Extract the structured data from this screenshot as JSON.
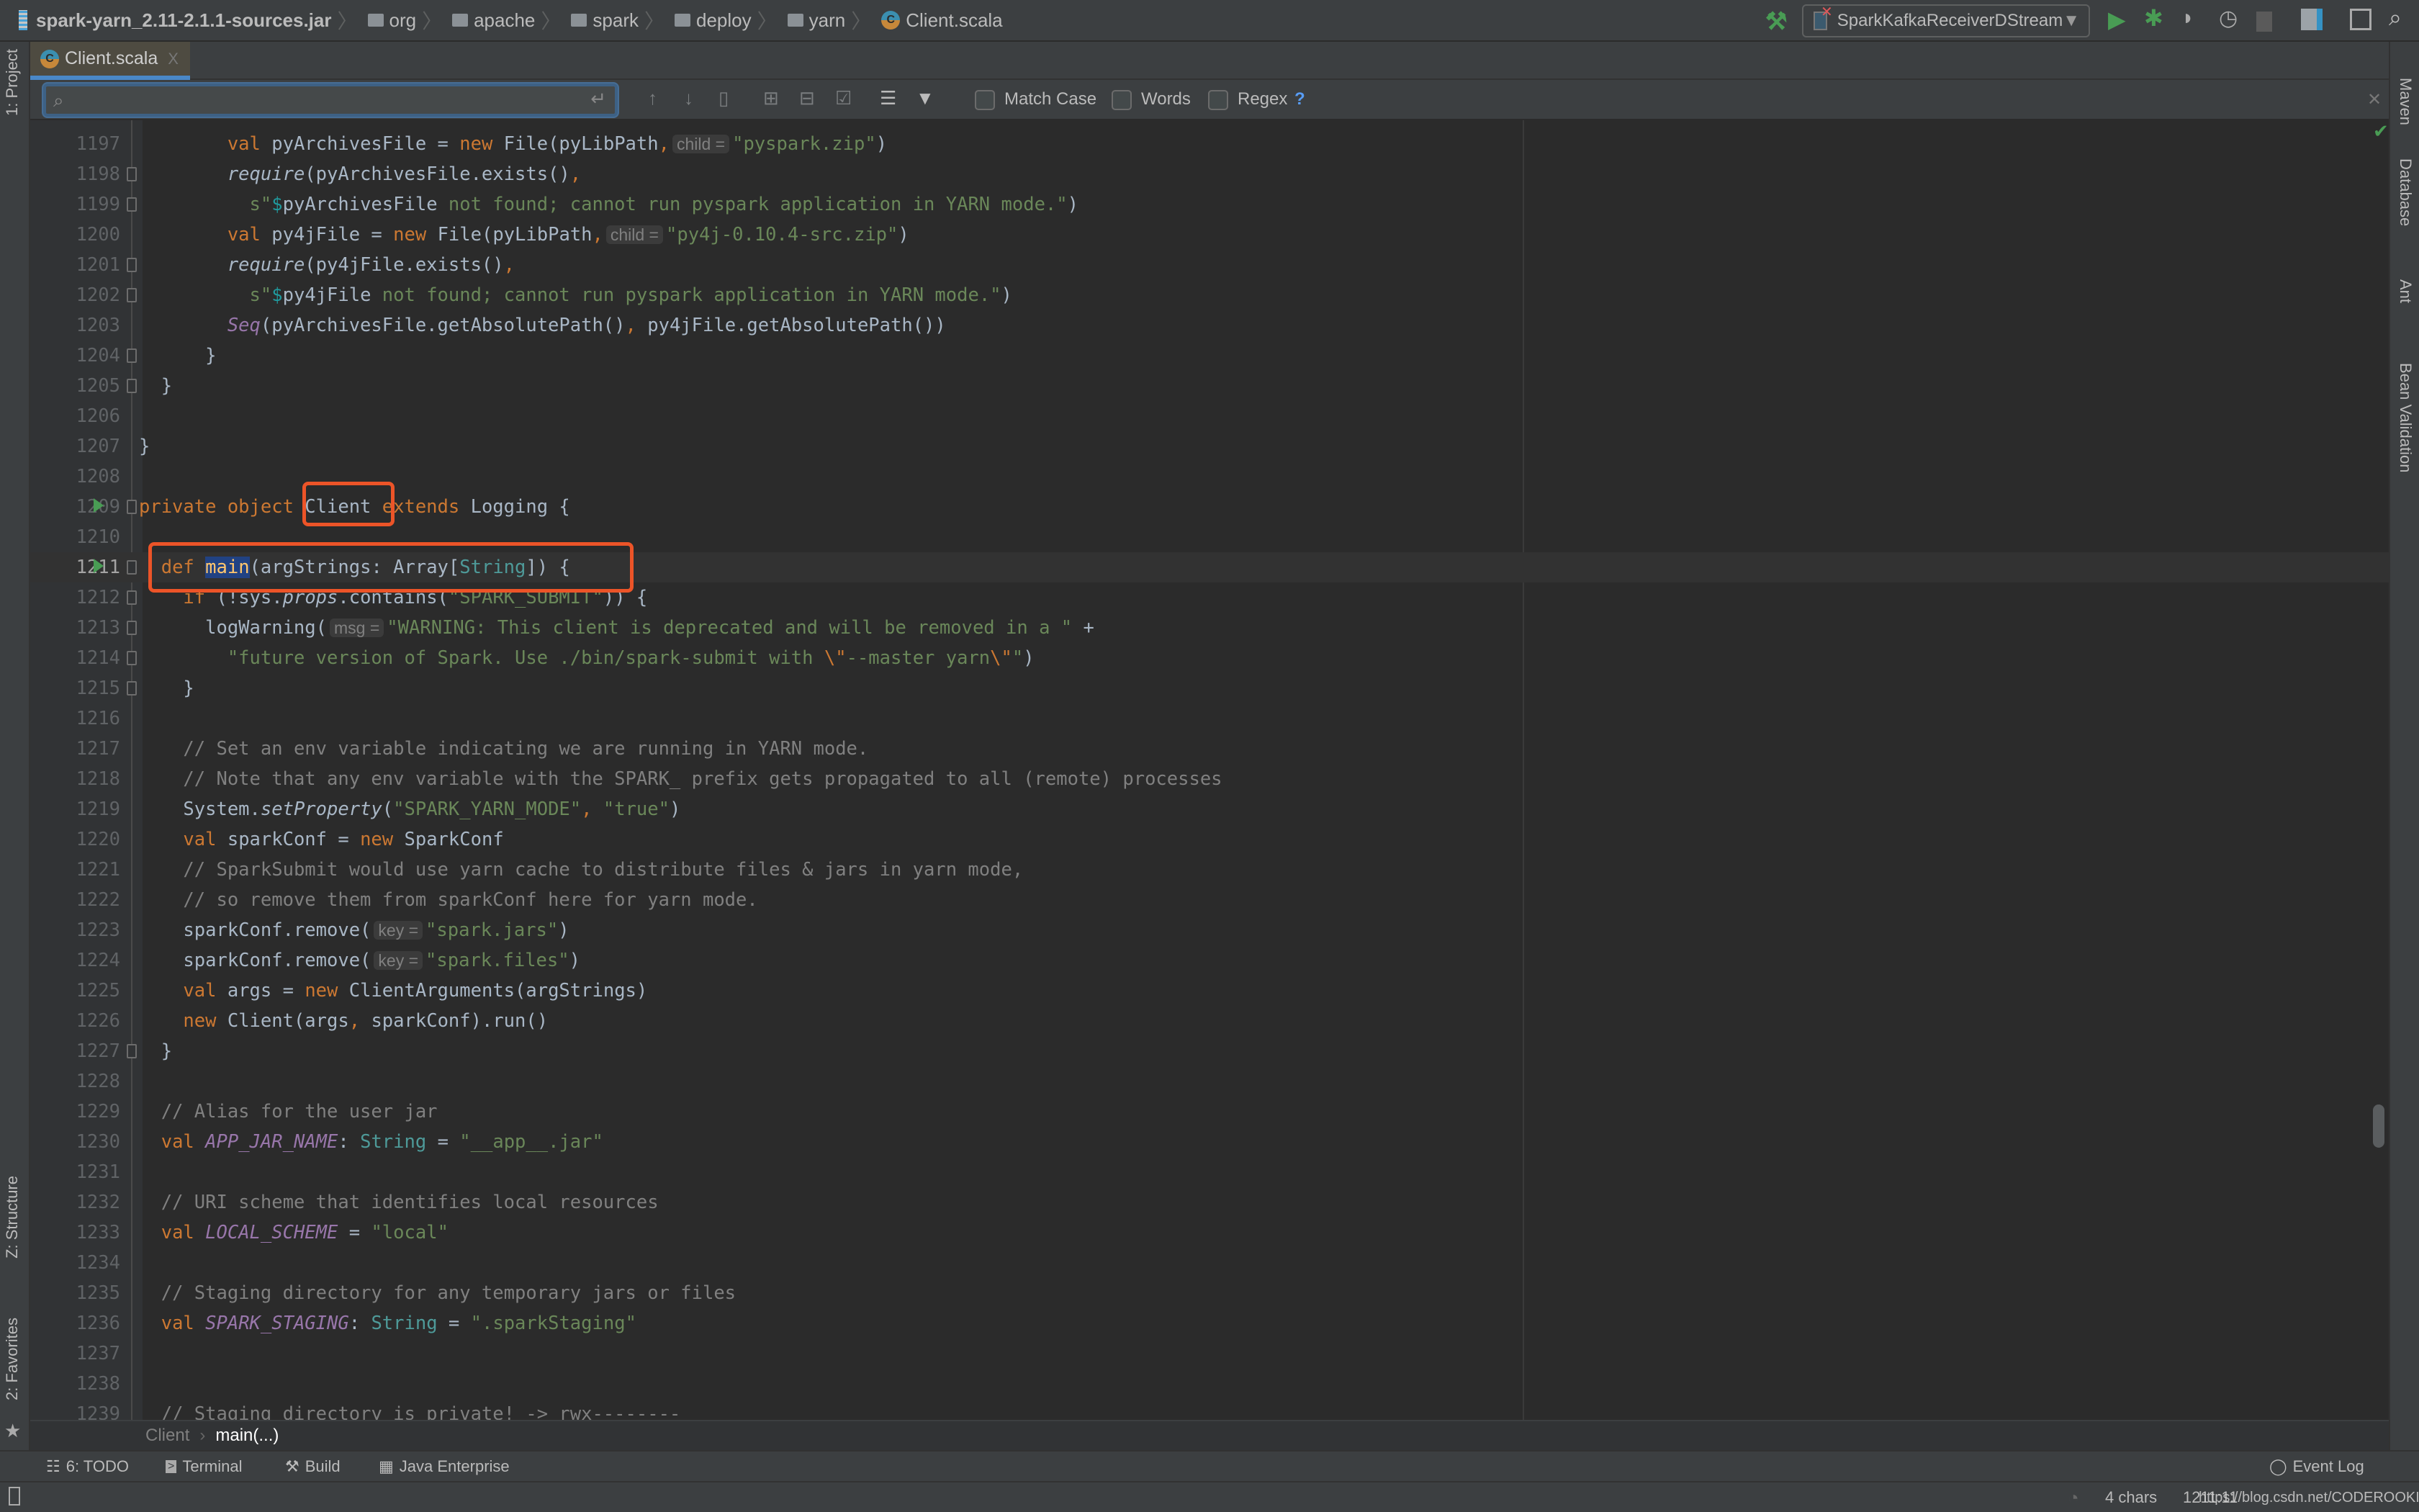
{
  "breadcrumb": {
    "jar": "spark-yarn_2.11-2.1.1-sources.jar",
    "folders": [
      "org",
      "apache",
      "spark",
      "deploy",
      "yarn"
    ],
    "file": "Client.scala"
  },
  "run_config": "SparkKafkaReceiverDStream",
  "toolbar_icons": [
    "build-hammer-icon",
    "run-icon",
    "debug-icon",
    "coverage-icon",
    "profile-icon",
    "stop-icon",
    "project-structure-icon",
    "terminal-window-icon",
    "search-icon"
  ],
  "tab": {
    "label": "Client.scala",
    "close": "X"
  },
  "search": {
    "value": "",
    "match_case": "Match Case",
    "words": "Words",
    "regex": "Regex",
    "help": "?",
    "match_case_checked": false,
    "words_checked": false,
    "regex_checked": false
  },
  "left_tools": [
    "1: Project",
    "Z: Structure",
    "2: Favorites"
  ],
  "right_tools": [
    "Maven",
    "Database",
    "Ant",
    "Bean Validation"
  ],
  "code": {
    "current_line": 1211,
    "lines": [
      {
        "n": "1197",
        "t": [
          [
            "i",
            "        "
          ],
          [
            "k",
            "val "
          ],
          [
            "i",
            "pyArchivesFile = "
          ],
          [
            "k",
            "new "
          ],
          [
            "i",
            "File(pyLibPath"
          ],
          [
            "k",
            ","
          ],
          [
            "h",
            "child ="
          ],
          [
            "s",
            "\"pyspark.zip\""
          ],
          [
            "i",
            ")"
          ]
        ]
      },
      {
        "n": "1198",
        "t": [
          [
            "i",
            "        "
          ],
          [
            "mi",
            "require"
          ],
          [
            "i",
            "(pyArchivesFile.exists()"
          ],
          [
            "k",
            ","
          ]
        ]
      },
      {
        "n": "1199",
        "t": [
          [
            "i",
            "          "
          ],
          [
            "s",
            "s\""
          ],
          [
            "d",
            "$"
          ],
          [
            "i",
            "pyArchivesFile"
          ],
          [
            "s",
            " not found; cannot run pyspark application in YARN mode.\""
          ],
          [
            "i",
            ")"
          ]
        ]
      },
      {
        "n": "1200",
        "t": [
          [
            "i",
            "        "
          ],
          [
            "k",
            "val "
          ],
          [
            "i",
            "py4jFile = "
          ],
          [
            "k",
            "new "
          ],
          [
            "i",
            "File(pyLibPath"
          ],
          [
            "k",
            ","
          ],
          [
            "h",
            "child ="
          ],
          [
            "s",
            "\"py4j-0.10.4-src.zip\""
          ],
          [
            "i",
            ")"
          ]
        ]
      },
      {
        "n": "1201",
        "t": [
          [
            "i",
            "        "
          ],
          [
            "mi",
            "require"
          ],
          [
            "i",
            "(py4jFile.exists()"
          ],
          [
            "k",
            ","
          ]
        ]
      },
      {
        "n": "1202",
        "t": [
          [
            "i",
            "          "
          ],
          [
            "s",
            "s\""
          ],
          [
            "d",
            "$"
          ],
          [
            "i",
            "py4jFile"
          ],
          [
            "s",
            " not found; cannot run pyspark application in YARN mode.\""
          ],
          [
            "i",
            ")"
          ]
        ]
      },
      {
        "n": "1203",
        "t": [
          [
            "i",
            "        "
          ],
          [
            "p",
            "Seq"
          ],
          [
            "i",
            "(pyArchivesFile.getAbsolutePath()"
          ],
          [
            "k",
            ", "
          ],
          [
            "i",
            "py4jFile.getAbsolutePath())"
          ]
        ]
      },
      {
        "n": "1204",
        "t": [
          [
            "i",
            "      }"
          ]
        ]
      },
      {
        "n": "1205",
        "t": [
          [
            "i",
            "  }"
          ]
        ]
      },
      {
        "n": "1206",
        "t": []
      },
      {
        "n": "1207",
        "t": [
          [
            "i",
            "}"
          ]
        ]
      },
      {
        "n": "1208",
        "t": []
      },
      {
        "n": "1209",
        "t": [
          [
            "k",
            "private object "
          ],
          [
            "i",
            "Client "
          ],
          [
            "k",
            "extends "
          ],
          [
            "i",
            "Logging {"
          ]
        ]
      },
      {
        "n": "1210",
        "t": []
      },
      {
        "n": "1211",
        "t": [
          [
            "i",
            "  "
          ],
          [
            "k",
            "def "
          ],
          [
            "fn",
            "main"
          ],
          [
            "i",
            "(argStrings: Array["
          ],
          [
            "t",
            "String"
          ],
          [
            "i",
            "]) {"
          ]
        ]
      },
      {
        "n": "1212",
        "t": [
          [
            "i",
            "    "
          ],
          [
            "k",
            "if "
          ],
          [
            "i",
            "(!sys."
          ],
          [
            "mi",
            "props"
          ],
          [
            "i",
            ".contains("
          ],
          [
            "s",
            "\"SPARK_SUBMIT\""
          ],
          [
            "i",
            ")) {"
          ]
        ]
      },
      {
        "n": "1213",
        "t": [
          [
            "i",
            "      logWarning("
          ],
          [
            "h",
            "msg ="
          ],
          [
            "s",
            "\"WARNING: This client is deprecated and will be removed in a \" "
          ],
          [
            "i",
            "+"
          ]
        ]
      },
      {
        "n": "1214",
        "t": [
          [
            "i",
            "        "
          ],
          [
            "s",
            "\"future version of Spark. Use ./bin/spark-submit with "
          ],
          [
            "e",
            "\\\""
          ],
          [
            "s",
            "--master yarn"
          ],
          [
            "e",
            "\\\""
          ],
          [
            "s",
            "\""
          ],
          [
            "i",
            ")"
          ]
        ]
      },
      {
        "n": "1215",
        "t": [
          [
            "i",
            "    }"
          ]
        ]
      },
      {
        "n": "1216",
        "t": []
      },
      {
        "n": "1217",
        "t": [
          [
            "i",
            "    "
          ],
          [
            "c",
            "// Set an env variable indicating we are running in YARN mode."
          ]
        ]
      },
      {
        "n": "1218",
        "t": [
          [
            "i",
            "    "
          ],
          [
            "c",
            "// Note that any env variable with the SPARK_ prefix gets propagated to all (remote) processes"
          ]
        ]
      },
      {
        "n": "1219",
        "t": [
          [
            "i",
            "    System."
          ],
          [
            "mi",
            "setProperty"
          ],
          [
            "i",
            "("
          ],
          [
            "s",
            "\"SPARK_YARN_MODE\""
          ],
          [
            "k",
            ", "
          ],
          [
            "s",
            "\"true\""
          ],
          [
            "i",
            ")"
          ]
        ]
      },
      {
        "n": "1220",
        "t": [
          [
            "i",
            "    "
          ],
          [
            "k",
            "val "
          ],
          [
            "i",
            "sparkConf = "
          ],
          [
            "k",
            "new "
          ],
          [
            "i",
            "SparkConf"
          ]
        ]
      },
      {
        "n": "1221",
        "t": [
          [
            "i",
            "    "
          ],
          [
            "c",
            "// SparkSubmit would use yarn cache to distribute files & jars in yarn mode,"
          ]
        ]
      },
      {
        "n": "1222",
        "t": [
          [
            "i",
            "    "
          ],
          [
            "c",
            "// so remove them from sparkConf here for yarn mode."
          ]
        ]
      },
      {
        "n": "1223",
        "t": [
          [
            "i",
            "    sparkConf.remove("
          ],
          [
            "h",
            "key ="
          ],
          [
            "s",
            "\"spark.jars\""
          ],
          [
            "i",
            ")"
          ]
        ]
      },
      {
        "n": "1224",
        "t": [
          [
            "i",
            "    sparkConf.remove("
          ],
          [
            "h",
            "key ="
          ],
          [
            "s",
            "\"spark.files\""
          ],
          [
            "i",
            ")"
          ]
        ]
      },
      {
        "n": "1225",
        "t": [
          [
            "i",
            "    "
          ],
          [
            "k",
            "val "
          ],
          [
            "i",
            "args = "
          ],
          [
            "k",
            "new "
          ],
          [
            "i",
            "ClientArguments(argStrings)"
          ]
        ]
      },
      {
        "n": "1226",
        "t": [
          [
            "i",
            "    "
          ],
          [
            "k",
            "new "
          ],
          [
            "i",
            "Client(args"
          ],
          [
            "k",
            ", "
          ],
          [
            "i",
            "sparkConf).run()"
          ]
        ]
      },
      {
        "n": "1227",
        "t": [
          [
            "i",
            "  }"
          ]
        ]
      },
      {
        "n": "1228",
        "t": []
      },
      {
        "n": "1229",
        "t": [
          [
            "i",
            "  "
          ],
          [
            "c",
            "// Alias for the user jar"
          ]
        ]
      },
      {
        "n": "1230",
        "t": [
          [
            "i",
            "  "
          ],
          [
            "k",
            "val "
          ],
          [
            "p",
            "APP_JAR_NAME"
          ],
          [
            "i",
            ": "
          ],
          [
            "t",
            "String "
          ],
          [
            "i",
            "= "
          ],
          [
            "s",
            "\"__app__.jar\""
          ]
        ]
      },
      {
        "n": "1231",
        "t": []
      },
      {
        "n": "1232",
        "t": [
          [
            "i",
            "  "
          ],
          [
            "c",
            "// URI scheme that identifies local resources"
          ]
        ]
      },
      {
        "n": "1233",
        "t": [
          [
            "i",
            "  "
          ],
          [
            "k",
            "val "
          ],
          [
            "p",
            "LOCAL_SCHEME "
          ],
          [
            "i",
            "= "
          ],
          [
            "s",
            "\"local\""
          ]
        ]
      },
      {
        "n": "1234",
        "t": []
      },
      {
        "n": "1235",
        "t": [
          [
            "i",
            "  "
          ],
          [
            "c",
            "// Staging directory for any temporary jars or files"
          ]
        ]
      },
      {
        "n": "1236",
        "t": [
          [
            "i",
            "  "
          ],
          [
            "k",
            "val "
          ],
          [
            "p",
            "SPARK_STAGING"
          ],
          [
            "i",
            ": "
          ],
          [
            "t",
            "String "
          ],
          [
            "i",
            "= "
          ],
          [
            "s",
            "\".sparkStaging\""
          ]
        ]
      },
      {
        "n": "1237",
        "t": []
      },
      {
        "n": "1238",
        "t": []
      },
      {
        "n": "1239",
        "t": [
          [
            "i",
            "  "
          ],
          [
            "c",
            "// Staging directory is private! -> rwx--------"
          ]
        ]
      }
    ]
  },
  "editor_breadcrumb": [
    "Client",
    "main(...)"
  ],
  "tool_windows": {
    "todo": "6: TODO",
    "terminal": "Terminal",
    "build": "Build",
    "java_enterprise": "Java Enterprise",
    "event_log": "Event Log"
  },
  "status": {
    "selection": "4 chars",
    "position": "1211:11",
    "watermark": "https://blog.csdn.net/CODEROOKIE_RUN"
  },
  "colors": {
    "highlight_box": "#ec5428",
    "keyword": "#cc7832",
    "string": "#6a8759",
    "comment": "#808080",
    "editor_bg": "#2b2b2b"
  }
}
